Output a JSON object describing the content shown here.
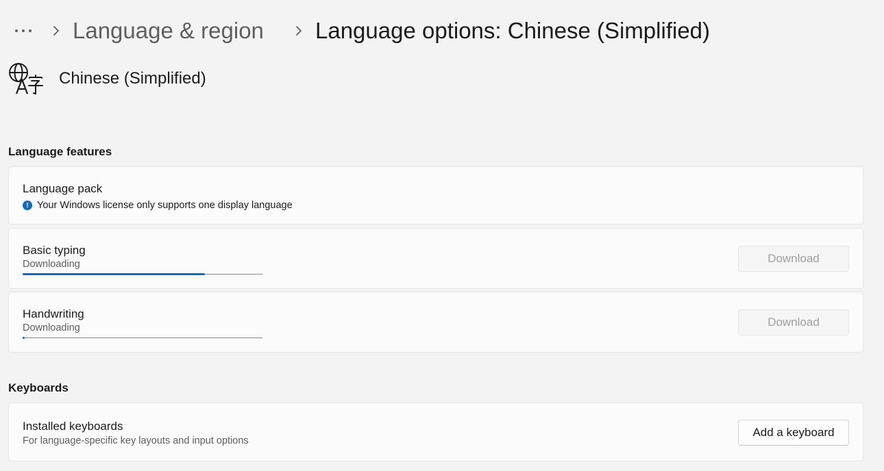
{
  "breadcrumb": {
    "more_icon": "more-horizontal-icon",
    "chevron_icon": "chevron-right-icon",
    "parent": "Language & region",
    "current": "Language options: Chinese (Simplified)"
  },
  "language": {
    "icon": "language-globe-icon",
    "name": "Chinese (Simplified)"
  },
  "sections": {
    "features_title": "Language features",
    "keyboards_title": "Keyboards"
  },
  "language_pack": {
    "title": "Language pack",
    "info_icon": "info-icon",
    "info_text": "Your Windows license only supports one display language"
  },
  "basic_typing": {
    "title": "Basic typing",
    "status": "Downloading",
    "progress": 0.76,
    "button_label": "Download",
    "button_enabled": false
  },
  "handwriting": {
    "title": "Handwriting",
    "status": "Downloading",
    "progress": 0.005,
    "button_label": "Download",
    "button_enabled": false
  },
  "installed_keyboards": {
    "title": "Installed keyboards",
    "subtitle": "For language-specific key layouts and input options",
    "button_label": "Add a keyboard"
  },
  "colors": {
    "accent": "#0f6cbd",
    "background": "#f3f3f3",
    "card": "#fbfbfb"
  }
}
